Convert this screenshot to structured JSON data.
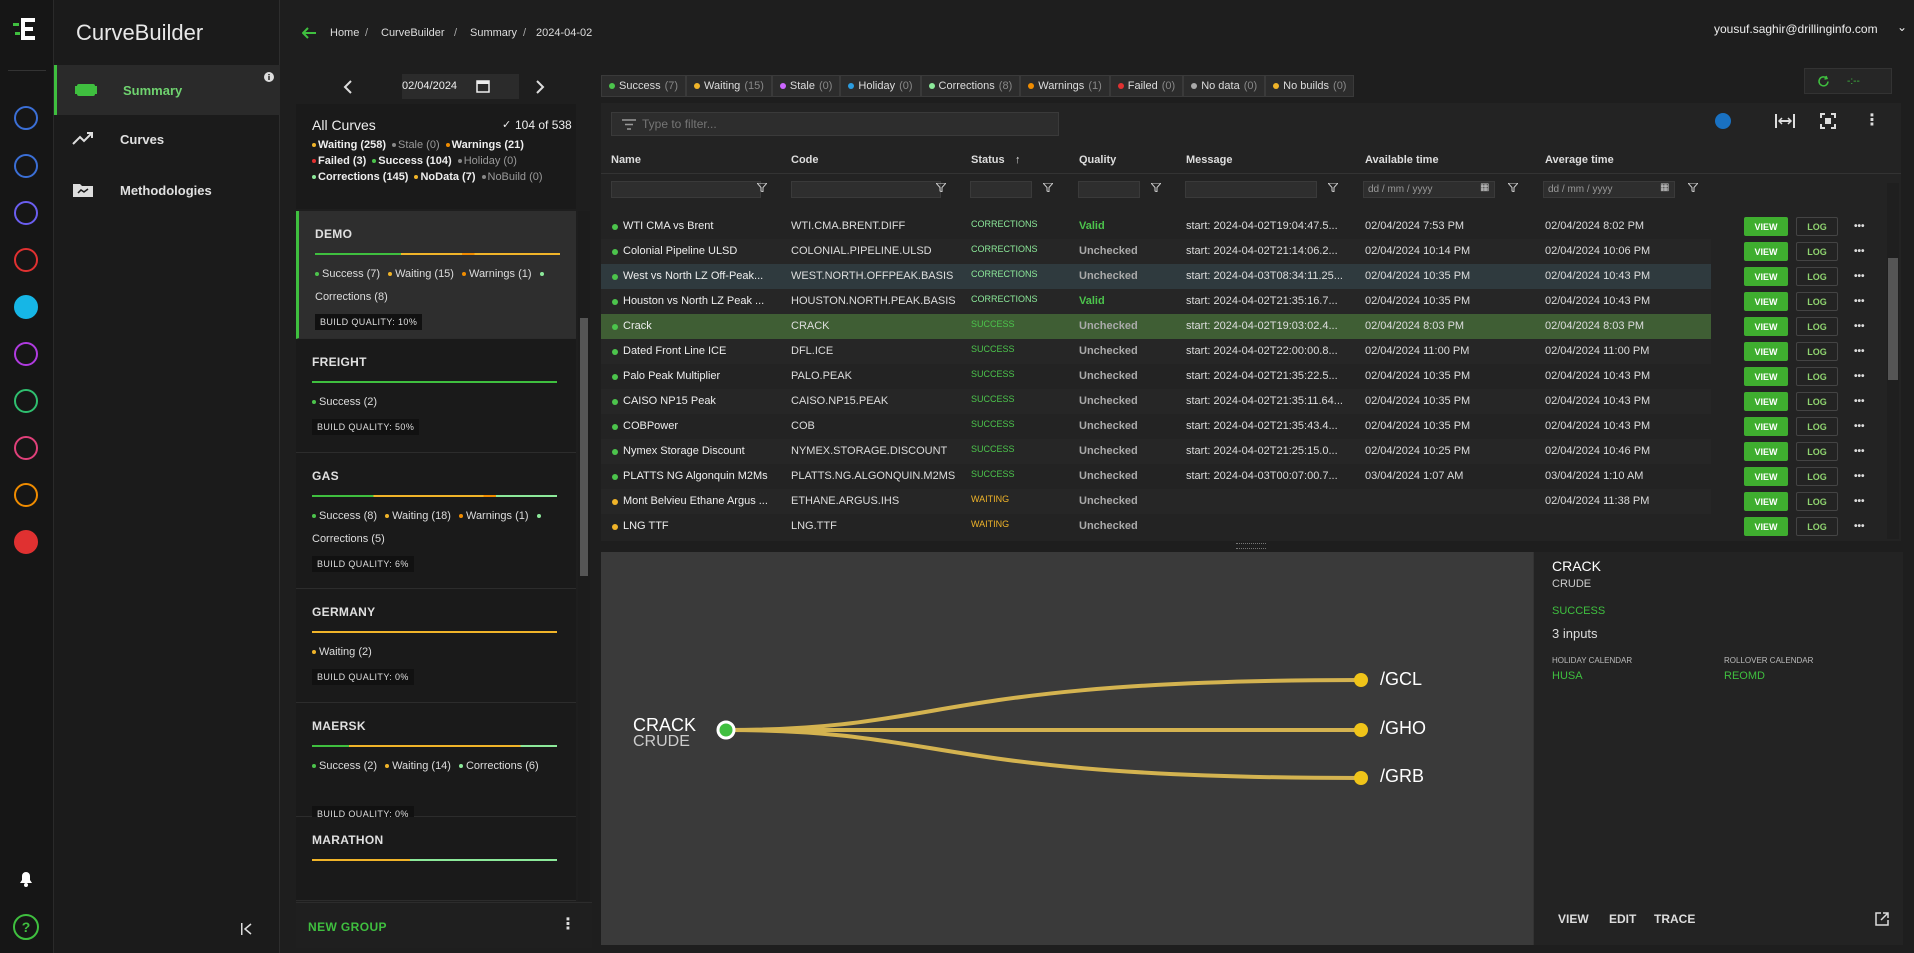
{
  "app": {
    "title": "CurveBuilder"
  },
  "nav": {
    "items": [
      {
        "label": "Summary",
        "icon": "summary-icon",
        "active": true
      },
      {
        "label": "Curves",
        "icon": "trending-up-icon",
        "active": false
      },
      {
        "label": "Methodologies",
        "icon": "folder-icon",
        "active": false
      }
    ]
  },
  "breadcrumb": [
    "Home",
    "CurveBuilder",
    "Summary",
    "2024-04-02"
  ],
  "user": {
    "email": "yousuf.saghir@drillinginfo.com"
  },
  "refresh": {
    "label": "-:--"
  },
  "datepicker": {
    "value": "02/04/2024"
  },
  "allcurves": {
    "title": "All Curves",
    "count": "104 of 538",
    "stats": [
      {
        "label": "Waiting (258)",
        "color": "#f0b429"
      },
      {
        "label": "Stale (0)",
        "color": "#888888"
      },
      {
        "label": "Warnings (21)",
        "color": "#f08c00"
      },
      {
        "label": "Failed (3)",
        "color": "#e03131"
      },
      {
        "label": "Success (104)",
        "color": "#4cc44c"
      },
      {
        "label": "Holiday (0)",
        "color": "#888888"
      },
      {
        "label": "Corrections (145)",
        "color": "#8ce99a"
      },
      {
        "label": "NoData (7)",
        "color": "#f0b429"
      },
      {
        "label": "NoBuild (0)",
        "color": "#888888"
      }
    ]
  },
  "groups": [
    {
      "name": "DEMO",
      "stats": [
        {
          "label": "Success (7)",
          "color": "#4cc44c"
        },
        {
          "label": "Waiting (15)",
          "color": "#f0b429"
        },
        {
          "label": "Warnings (1)",
          "color": "#f08c00"
        },
        {
          "label": "Corrections (8)",
          "color": "#8ce99a"
        }
      ],
      "quality": "BUILD QUALITY: 10%"
    },
    {
      "name": "FREIGHT",
      "stats": [
        {
          "label": "Success (2)",
          "color": "#4cc44c"
        }
      ],
      "quality": "BUILD QUALITY: 50%"
    },
    {
      "name": "GAS",
      "stats": [
        {
          "label": "Success (8)",
          "color": "#4cc44c"
        },
        {
          "label": "Waiting (18)",
          "color": "#f0b429"
        },
        {
          "label": "Warnings (1)",
          "color": "#f08c00"
        },
        {
          "label": "Corrections (5)",
          "color": "#8ce99a"
        }
      ],
      "quality": "BUILD QUALITY: 6%"
    },
    {
      "name": "GERMANY",
      "stats": [
        {
          "label": "Waiting (2)",
          "color": "#f0b429"
        }
      ],
      "quality": "BUILD QUALITY: 0%"
    },
    {
      "name": "MAERSK",
      "stats": [
        {
          "label": "Success (2)",
          "color": "#4cc44c"
        },
        {
          "label": "Waiting (14)",
          "color": "#f0b429"
        },
        {
          "label": "Corrections (6)",
          "color": "#8ce99a"
        }
      ],
      "quality": "BUILD QUALITY: 0%"
    },
    {
      "name": "MARATHON",
      "stats": [],
      "quality": ""
    }
  ],
  "newgroup": {
    "label": "NEW GROUP"
  },
  "chips": [
    {
      "label": "Success",
      "count": "(7)",
      "color": "#4cc44c"
    },
    {
      "label": "Waiting",
      "count": "(15)",
      "color": "#f0b429"
    },
    {
      "label": "Stale",
      "count": "(0)",
      "color": "#cc66ff"
    },
    {
      "label": "Holiday",
      "count": "(0)",
      "color": "#2b9de0"
    },
    {
      "label": "Corrections",
      "count": "(8)",
      "color": "#8ce99a"
    },
    {
      "label": "Warnings",
      "count": "(1)",
      "color": "#f08c00"
    },
    {
      "label": "Failed",
      "count": "(0)",
      "color": "#e03131"
    },
    {
      "label": "No data",
      "count": "(0)",
      "color": "#aaaaaa"
    },
    {
      "label": "No builds",
      "count": "(0)",
      "color": "#f0b429"
    }
  ],
  "filter": {
    "placeholder": "Type to filter..."
  },
  "table": {
    "columns": [
      "Name",
      "Code",
      "Status",
      "Quality",
      "Message",
      "Available time",
      "Average time"
    ],
    "date_placeholder": "dd / mm / yyyy",
    "rows": [
      {
        "name": "WTI CMA vs Brent",
        "code": "WTI.CMA.BRENT.DIFF",
        "status": "CORRECTIONS",
        "quality": "Valid",
        "message": "start: 2024-04-02T19:04:47.5...",
        "avail": "02/04/2024 7:53 PM",
        "avg": "02/04/2024 8:02 PM",
        "dot": "#4cc44c"
      },
      {
        "name": "Colonial Pipeline ULSD",
        "code": "COLONIAL.PIPELINE.ULSD",
        "status": "CORRECTIONS",
        "quality": "Unchecked",
        "message": "start: 2024-04-02T21:14:06.2...",
        "avail": "02/04/2024 10:14 PM",
        "avg": "02/04/2024 10:06 PM",
        "dot": "#4cc44c"
      },
      {
        "name": "West vs North LZ Off-Peak...",
        "code": "WEST.NORTH.OFFPEAK.BASIS",
        "status": "CORRECTIONS",
        "quality": "Unchecked",
        "message": "start: 2024-04-03T08:34:11.25...",
        "avail": "02/04/2024 10:35 PM",
        "avg": "02/04/2024 10:43 PM",
        "dot": "#4cc44c"
      },
      {
        "name": "Houston vs North LZ Peak ...",
        "code": "HOUSTON.NORTH.PEAK.BASIS",
        "status": "CORRECTIONS",
        "quality": "Valid",
        "message": "start: 2024-04-02T21:35:16.7...",
        "avail": "02/04/2024 10:35 PM",
        "avg": "02/04/2024 10:43 PM",
        "dot": "#4cc44c"
      },
      {
        "name": "Crack",
        "code": "CRACK",
        "status": "SUCCESS",
        "quality": "Unchecked",
        "message": "start: 2024-04-02T19:03:02.4...",
        "avail": "02/04/2024 8:03 PM",
        "avg": "02/04/2024 8:03 PM",
        "dot": "#4cc44c"
      },
      {
        "name": "Dated Front Line ICE",
        "code": "DFL.ICE",
        "status": "SUCCESS",
        "quality": "Unchecked",
        "message": "start: 2024-04-02T22:00:00.8...",
        "avail": "02/04/2024 11:00 PM",
        "avg": "02/04/2024 11:00 PM",
        "dot": "#4cc44c"
      },
      {
        "name": "Palo Peak Multiplier",
        "code": "PALO.PEAK",
        "status": "SUCCESS",
        "quality": "Unchecked",
        "message": "start: 2024-04-02T21:35:22.5...",
        "avail": "02/04/2024 10:35 PM",
        "avg": "02/04/2024 10:43 PM",
        "dot": "#4cc44c"
      },
      {
        "name": "CAISO NP15 Peak",
        "code": "CAISO.NP15.PEAK",
        "status": "SUCCESS",
        "quality": "Unchecked",
        "message": "start: 2024-04-02T21:35:11.64...",
        "avail": "02/04/2024 10:35 PM",
        "avg": "02/04/2024 10:43 PM",
        "dot": "#4cc44c"
      },
      {
        "name": "COBPower",
        "code": "COB",
        "status": "SUCCESS",
        "quality": "Unchecked",
        "message": "start: 2024-04-02T21:35:43.4...",
        "avail": "02/04/2024 10:35 PM",
        "avg": "02/04/2024 10:43 PM",
        "dot": "#4cc44c"
      },
      {
        "name": "Nymex Storage Discount",
        "code": "NYMEX.STORAGE.DISCOUNT",
        "status": "SUCCESS",
        "quality": "Unchecked",
        "message": "start: 2024-04-02T21:25:15.0...",
        "avail": "02/04/2024 10:25 PM",
        "avg": "02/04/2024 10:46 PM",
        "dot": "#4cc44c"
      },
      {
        "name": "PLATTS NG Algonquin M2Ms",
        "code": "PLATTS.NG.ALGONQUIN.M2MS",
        "status": "SUCCESS",
        "quality": "Unchecked",
        "message": "start: 2024-04-03T00:07:00.7...",
        "avail": "03/04/2024 1:07 AM",
        "avg": "03/04/2024 1:10 AM",
        "dot": "#4cc44c"
      },
      {
        "name": "Mont Belvieu Ethane Argus ...",
        "code": "ETHANE.ARGUS.IHS",
        "status": "WAITING",
        "quality": "Unchecked",
        "message": "",
        "avail": "",
        "avg": "02/04/2024 11:38 PM",
        "dot": "#f0b429"
      },
      {
        "name": "LNG TTF",
        "code": "LNG.TTF",
        "status": "WAITING",
        "quality": "Unchecked",
        "message": "",
        "avail": "",
        "avg": "",
        "dot": "#f0b429"
      }
    ],
    "view_label": "VIEW",
    "log_label": "LOG"
  },
  "graph": {
    "root_name": "CRACK",
    "root_group": "CRUDE",
    "inputs": [
      "/GCL",
      "/GHO",
      "/GRB"
    ]
  },
  "detail": {
    "name": "CRACK",
    "group": "CRUDE",
    "status": "SUCCESS",
    "inputs": "3 inputs",
    "holiday_label": "HOLIDAY CALENDAR",
    "holiday_value": "HUSA",
    "rollover_label": "ROLLOVER CALENDAR",
    "rollover_value": "REOMD",
    "actions": [
      "VIEW",
      "EDIT",
      "TRACE"
    ]
  },
  "colors": {
    "accent": "#3fbf3f",
    "success": "#4cc44c",
    "waiting": "#f0b429",
    "corrections": "#8ce99a",
    "link": "#d4b350"
  }
}
